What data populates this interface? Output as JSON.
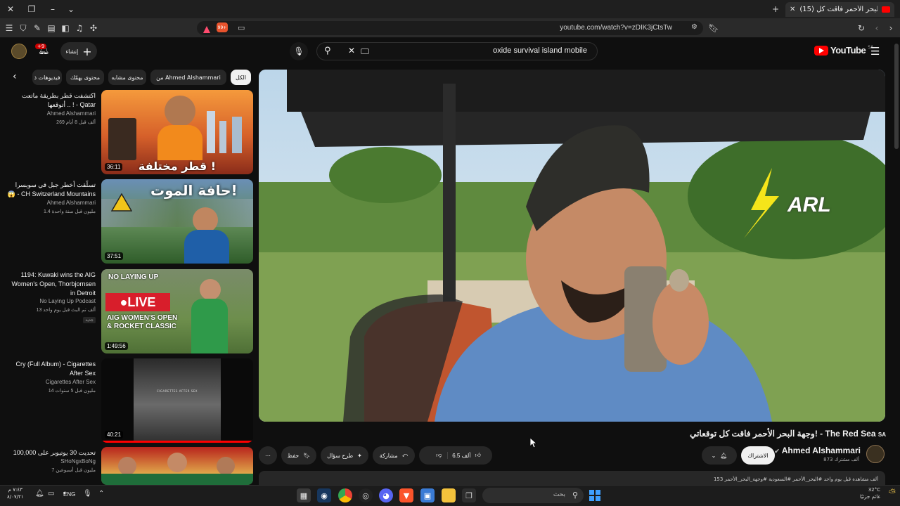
{
  "browser": {
    "tab_title": "(15) وجهة البحر الأحمر فاقت كل",
    "url": "youtube.com/watch?v=zDIK3jCtsTw",
    "badge_count": "99+"
  },
  "header": {
    "logo": "YouTube",
    "region": "SA",
    "search_query": "oxide survival island mobile",
    "create_label": "إنشاء",
    "notif_count": "+9"
  },
  "chips": [
    "الكل",
    "من Ahmed Alshammari",
    "محتوى مشابه",
    "محتوى يهمّك",
    "فيديوهات ذ"
  ],
  "recommendations": [
    {
      "title": "اكتشفت قطر بطريقة ماتعت أتوقعها .. ! - Qatar",
      "flag": "QA",
      "channel": "Ahmed Alshammari",
      "meta": "269 ألف  قبل 8 أيام",
      "duration": "36:11",
      "thumb_text": "قطر مختلفة !"
    },
    {
      "title": "تسلّقت أخطر جبل في سويسرا 😱 - CH Switzerland Mountains",
      "flag": "",
      "channel": "Ahmed Alshammari",
      "meta": "1.4 مليون  قبل سنة واحدة",
      "duration": "37:51",
      "thumb_text": "حافة الموت!"
    },
    {
      "title": "1194: Kuwaki wins the AIG Women's Open, Thorbjornsen in Detroit",
      "flag": "",
      "channel": "No Laying Up Podcast",
      "meta": "13 ألف  تم البث قبل يوم واحد",
      "new_badge": "جديد",
      "duration": "1:49:56",
      "thumb_text": "NO LAYING UP"
    },
    {
      "title": "Cry (Full Album) - Cigarettes After Sex",
      "flag": "",
      "channel": "Cigarettes After Sex",
      "meta": "14 مليون  قبل 5 سنوات",
      "duration": "40:21",
      "thumb_text": "CIGARETTES AFTER SEX"
    },
    {
      "title": "تحديت 30 يوتيوبر على 100,000 دولار!",
      "flag": "",
      "channel": "SHoNgxBoNg",
      "meta": "7 مليون  قبل أسبوعين",
      "duration": "",
      "thumb_text": ""
    }
  ],
  "video": {
    "title": "وجهة البحر الأحمر فاقت كل توقعاتي! - The Red Sea",
    "flag": "SA",
    "channel": "Ahmed Alshammari",
    "subs": "873 ألف مشترك",
    "subscribe_label": "الاشتراك",
    "likes": "6.5 ألف",
    "share_label": "مشاركة",
    "ask_label": "طرح سؤال",
    "save_label": "حفظ",
    "description_preview": "153 ألف مشاهدة  قبل يوم واحد  #البحر_الأحمر #السعودية #وجهة_البحر_الأحمر",
    "watermark": "ARL"
  },
  "taskbar": {
    "search_placeholder": "بحث",
    "lang": "ENG",
    "time": "٧:٤٣ م",
    "date": "٨/٠٧/٢١",
    "weather_temp": "32°C",
    "weather_desc": "غائم جزئيًا"
  },
  "colors": {
    "yt_red": "#ff0000",
    "accent": "#3ea6ff",
    "bg": "#0f0f0f"
  }
}
